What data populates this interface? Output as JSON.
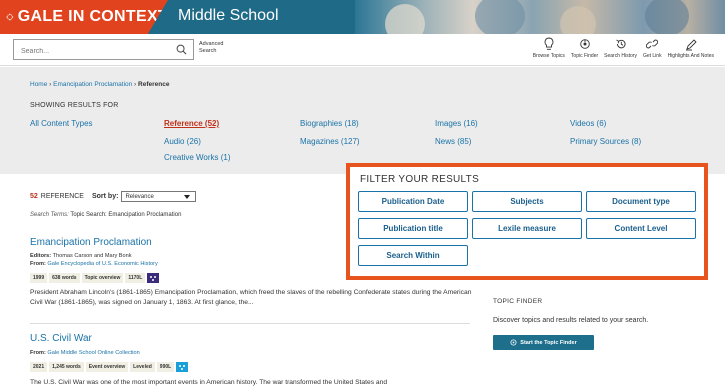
{
  "banner": {
    "brand": "GALE IN CONTEXT",
    "edition": "Middle School"
  },
  "toolbar": {
    "search_placeholder": "Search...",
    "advanced_search": "Advanced Search",
    "tools": [
      {
        "label": "Browse Topics",
        "icon": "lightbulb-icon"
      },
      {
        "label": "Topic Finder",
        "icon": "topic-finder-icon"
      },
      {
        "label": "Search History",
        "icon": "history-icon"
      },
      {
        "label": "Get Link",
        "icon": "link-icon"
      },
      {
        "label": "Highlights And Notes",
        "icon": "pencil-icon"
      }
    ]
  },
  "breadcrumb": {
    "home": "Home",
    "sep": " › ",
    "parent": "Emancipation Proclamation",
    "current": "Reference"
  },
  "showing_label": "SHOWING RESULTS FOR",
  "content_types": [
    "All Content Types",
    "Reference (52)",
    "Audio (26)",
    "Creative Works (1)",
    "Biographies (18)",
    "Magazines (127)",
    "Images (16)",
    "News (85)",
    "Videos (6)",
    "Primary Sources (8)"
  ],
  "results_header": {
    "count": "52",
    "count_label": "REFERENCE",
    "sort_label": "Sort by:",
    "sort_value": "Relevance",
    "search_terms_label": "Search Terms:",
    "search_terms": "Topic Search: Emancipation Proclamation"
  },
  "results": [
    {
      "title": "Emancipation Proclamation",
      "line1_label": "Editors:",
      "line1_value": "Thomas Carson and Mary Bonk",
      "line2_label": "From:",
      "line2_value": "Gale Encyclopedia of U.S. Economic History",
      "tags": [
        "1999",
        "638 words",
        "Topic overview",
        "1170L"
      ],
      "snippet": "President Abraham Lincoln's (1861-1865) Emancipation Proclamation, which freed the slaves of the rebelling Confederate states during the American Civil War (1861-1865), was signed on January 1, 1863. At first glance, the..."
    },
    {
      "title": "U.S. Civil War",
      "line1_label": "From:",
      "line1_value": "Gale Middle School Online Collection",
      "tags": [
        "2021",
        "1,245 words",
        "Event overview",
        "Leveled",
        "990L"
      ],
      "snippet": "The U.S. Civil War was one of the most important events in American history. The war transformed the United States and"
    }
  ],
  "topic_finder": {
    "label": "TOPIC FINDER",
    "text": "Discover topics and results related to your search.",
    "button": "Start the Topic Finder"
  },
  "filter": {
    "title": "FILTER YOUR RESULTS",
    "buttons": [
      "Publication Date",
      "Subjects",
      "Document type",
      "Publication title",
      "Lexile measure",
      "Content Level",
      "Search Within"
    ]
  },
  "colors": {
    "brand": "#e0431e",
    "banner": "#1f6a86",
    "link": "#1a73a8",
    "active": "#c0311a",
    "filter_border": "#e8541e"
  }
}
